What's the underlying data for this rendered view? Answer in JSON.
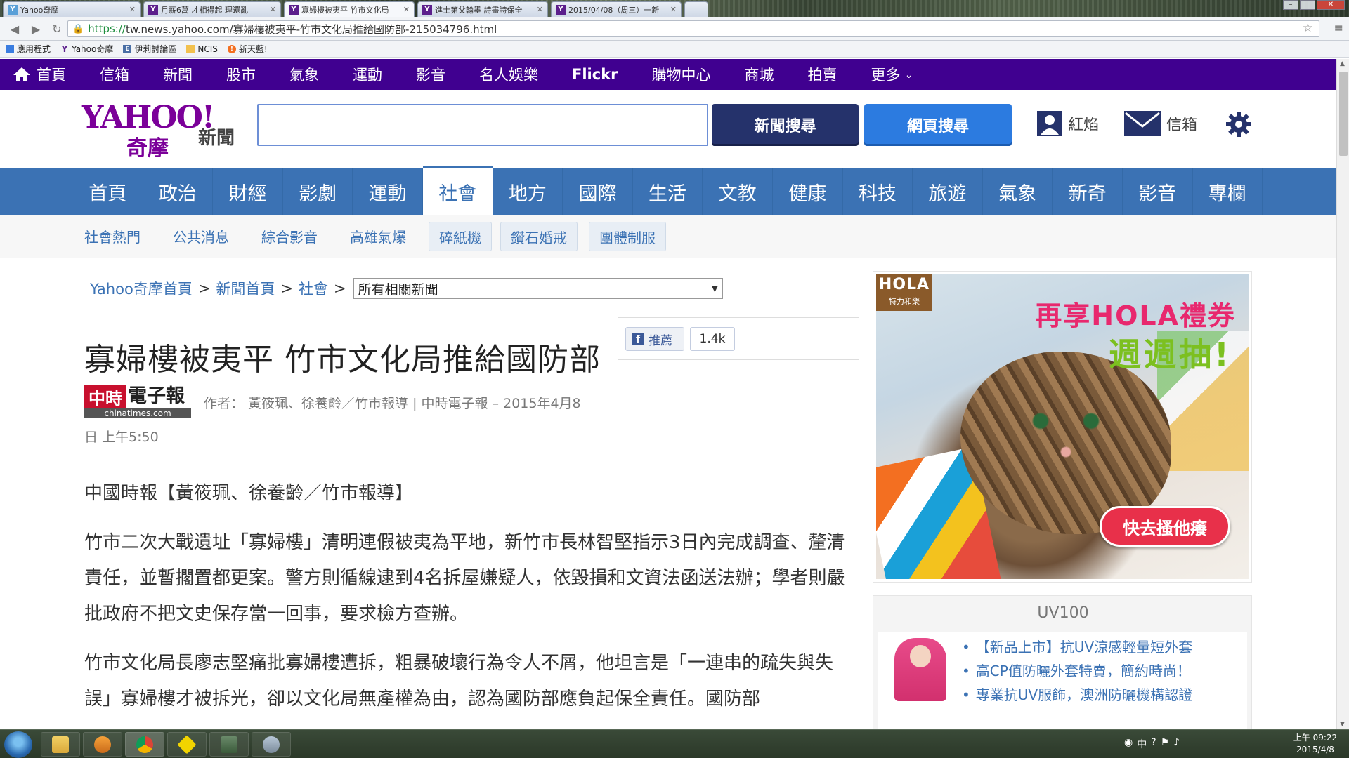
{
  "browser": {
    "tabs": [
      {
        "title": "Yahoo奇摩",
        "fav": "Y"
      },
      {
        "title": "月薪6萬 才相得起 理還亂",
        "fav": "Y"
      },
      {
        "title": "寡婦樓被夷平 竹市文化局",
        "fav": "Y"
      },
      {
        "title": "進士第父翰墨 詩畫詩保全",
        "fav": "Y"
      },
      {
        "title": "2015/04/08（周三）一新",
        "fav": "Y"
      }
    ],
    "url_scheme": "https://",
    "url_rest": "tw.news.yahoo.com/寡婦樓被夷平-竹市文化局推給國防部-215034796.html",
    "bookmarks": [
      "應用程式",
      "Yahoo奇摩",
      "伊莉討論區",
      "NCIS",
      "新天藍!"
    ]
  },
  "topbar": {
    "items": [
      "首頁",
      "信箱",
      "新聞",
      "股市",
      "氣象",
      "運動",
      "影音",
      "名人娛樂",
      "Flickr",
      "購物中心",
      "商城",
      "拍賣",
      "更多"
    ]
  },
  "header": {
    "logo_yahoo": "YAHOO!",
    "logo_qimo": "奇摩",
    "logo_news": "新聞",
    "search_value": "",
    "btn_news": "新聞搜尋",
    "btn_web": "網頁搜尋",
    "user_label": "紅焰",
    "mail_label": "信箱"
  },
  "nav": {
    "items": [
      "首頁",
      "政治",
      "財經",
      "影劇",
      "運動",
      "社會",
      "地方",
      "國際",
      "生活",
      "文教",
      "健康",
      "科技",
      "旅遊",
      "氣象",
      "新奇",
      "影音",
      "專欄"
    ],
    "active": "社會"
  },
  "subnav": {
    "links": [
      "社會熱門",
      "公共消息",
      "綜合影音",
      "高雄氣爆"
    ],
    "boxed": [
      "碎紙機",
      "鑽石婚戒",
      "團體制服"
    ]
  },
  "breadcrumb": {
    "items": [
      "Yahoo奇摩首頁",
      "新聞首頁",
      "社會"
    ],
    "sep": ">",
    "select_value": "所有相關新聞"
  },
  "article": {
    "title": "寡婦樓被夷平 竹市文化局推給國防部",
    "fb_label": "推薦",
    "fb_count": "1.4k",
    "source_logo": {
      "red": "中時",
      "name": "電子報",
      "domain": "chinatimes.com"
    },
    "byline": "作者： 黃筱珮、徐養齡／竹市報導 | 中時電子報 – 2015年4月8",
    "byline2": "日 上午5:50",
    "paragraphs": [
      "中國時報【黃筱珮、徐養齡／竹市報導】",
      "竹市二次大戰遺址「寡婦樓」清明連假被夷為平地，新竹市長林智堅指示3日內完成調查、釐清責任，並暫擱置都更案。警方則循線逮到4名拆屋嫌疑人，依毀損和文資法函送法辦；學者則嚴批政府不把文史保存當一回事，要求檢方查辦。",
      "竹市文化局長廖志堅痛批寡婦樓遭拆，粗暴破壞行為令人不屑，他坦言是「一連串的疏失與失誤」寡婦樓才被拆光，卻以文化局無產權為由，認為國防部應負起保全責任。國防部"
    ]
  },
  "ad": {
    "brand": "HOLA",
    "brand_sub": "特力和樂",
    "line1": "再享HOLA禮券",
    "line2": "週週抽!",
    "cta": "快去搔他癢"
  },
  "uv": {
    "title": "UV100",
    "items": [
      "【新品上市】抗UV涼感輕量短外套",
      "高CP值防曬外套特賣，簡約時尚！",
      "專業抗UV服飾，澳洲防曬機構認證"
    ]
  },
  "taskbar": {
    "clock_time": "上午 09:22",
    "clock_date": "2015/4/8",
    "tray": "中"
  },
  "colors": {
    "yahoo_purple": "#400090",
    "nav_blue": "#3b72b4",
    "btn_navy": "#25326b",
    "btn_blue": "#2c7be0"
  }
}
